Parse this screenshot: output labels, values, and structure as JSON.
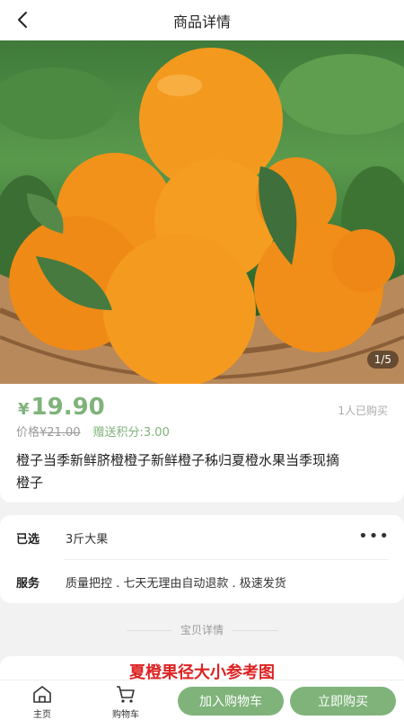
{
  "header": {
    "title": "商品详情"
  },
  "gallery": {
    "pager": "1/5"
  },
  "product": {
    "currency": "¥",
    "price": "19.90",
    "sold_text": "1人已购买",
    "original_label": "价格",
    "original_price": "¥21.00",
    "points_text": "赠送积分:3.00",
    "name": "橙子当季新鲜脐橙橙子新鲜橙子秭归夏橙水果当季现摘橙子"
  },
  "specs": {
    "selected_label": "已选",
    "selected_value": "3斤大果",
    "service_label": "服务",
    "service_value": "质量把控 . 七天无理由自动退款 . 极速发货"
  },
  "detail": {
    "section_label": "宝贝详情",
    "image_title": "夏橙果径大小参考图"
  },
  "tabbar": {
    "home_label": "主页",
    "cart_label": "购物车",
    "add_cart_label": "加入购物车",
    "buy_now_label": "立即购买"
  },
  "colors": {
    "accent": "#7fb37a",
    "detail_title": "#dd2222"
  }
}
